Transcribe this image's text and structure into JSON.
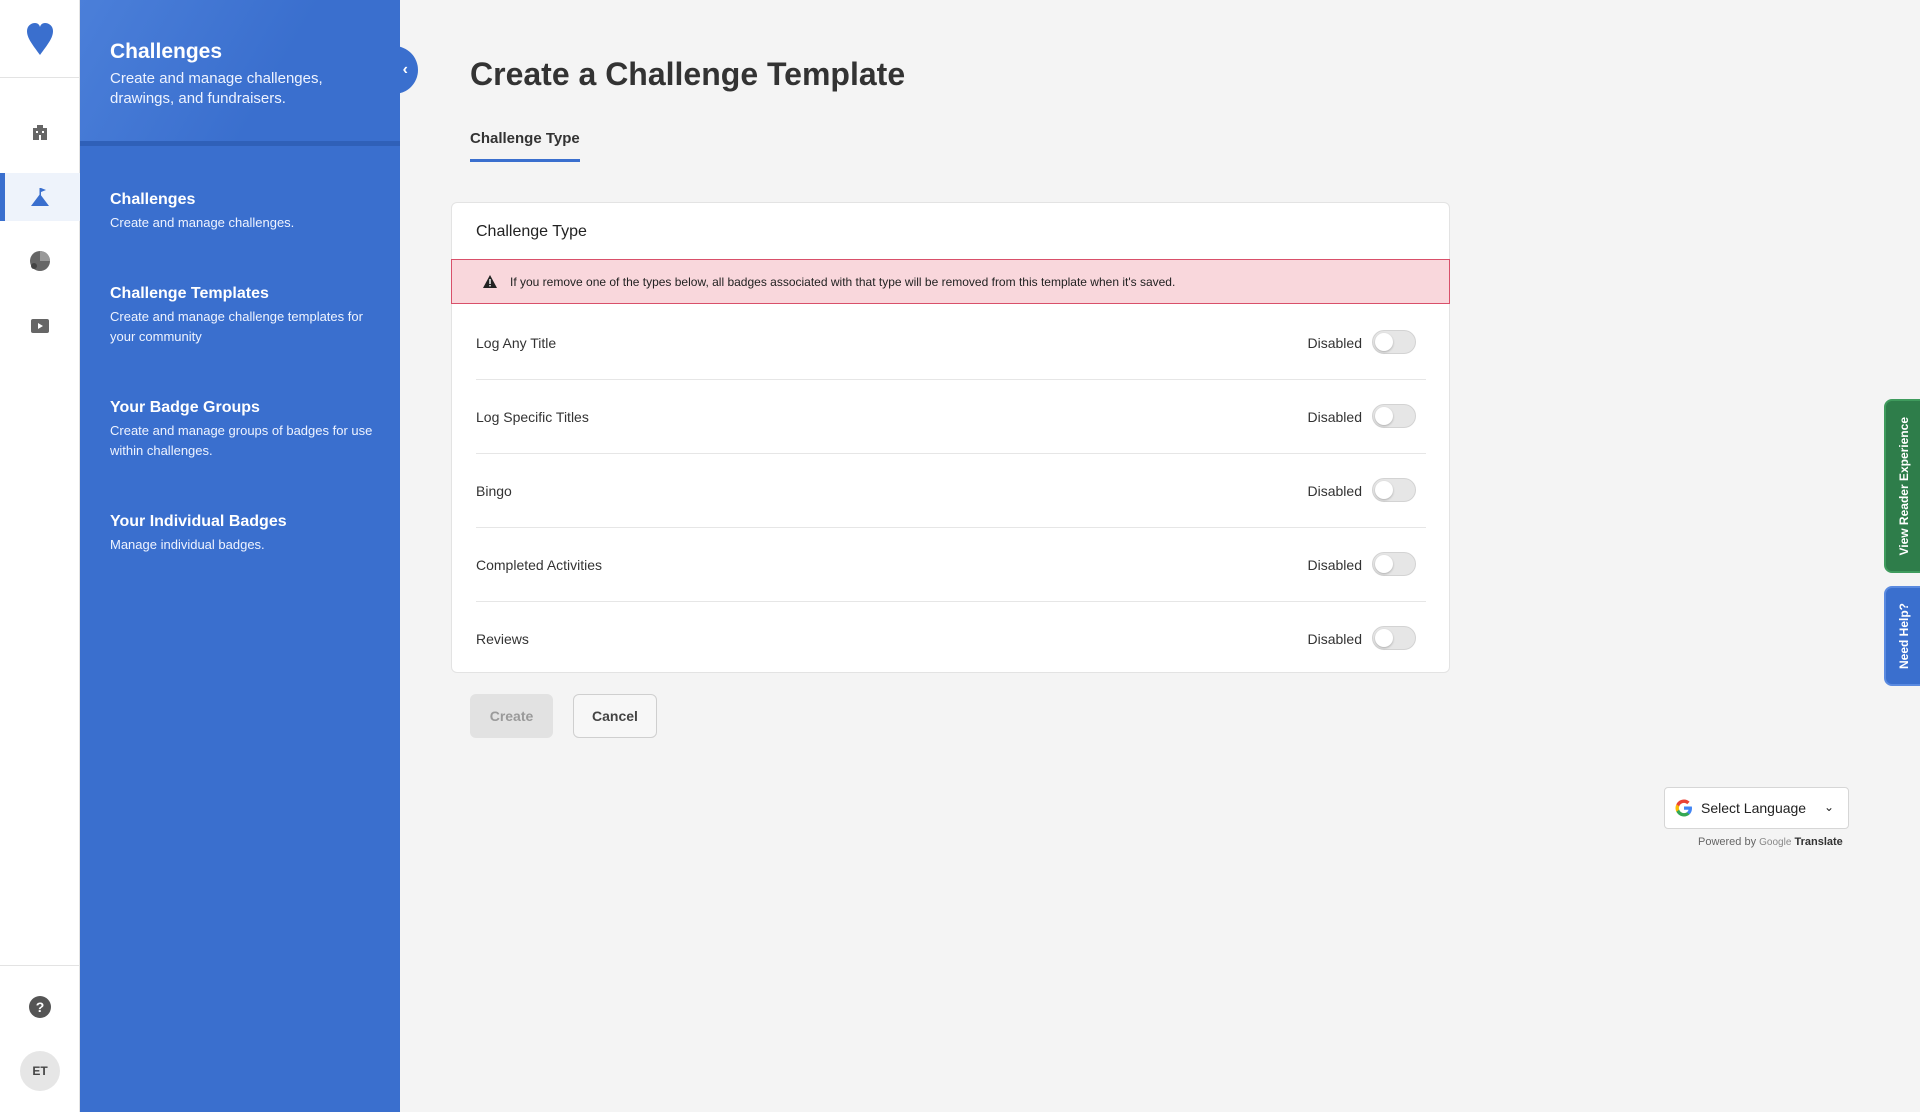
{
  "rail": {
    "items": [
      {
        "icon": "building-icon"
      },
      {
        "icon": "flag-mountain-icon",
        "active": true
      },
      {
        "icon": "pie-chart-icon"
      },
      {
        "icon": "video-play-icon"
      }
    ],
    "help_glyph": "?",
    "avatar_initials": "ET"
  },
  "sidebar": {
    "title": "Challenges",
    "subtitle": "Create and manage challenges, drawings, and fundraisers.",
    "collapse_glyph": "‹",
    "items": [
      {
        "title": "Challenges",
        "desc": "Create and manage challenges."
      },
      {
        "title": "Challenge Templates",
        "desc": "Create and manage challenge templates for your community"
      },
      {
        "title": "Your Badge Groups",
        "desc": "Create and manage groups of badges for use within challenges."
      },
      {
        "title": "Your Individual Badges",
        "desc": "Manage individual badges."
      }
    ]
  },
  "main": {
    "title": "Create a Challenge Template",
    "tab": "Challenge Type",
    "card": {
      "title": "Challenge Type",
      "alert": "If you remove one of the types below, all badges associated with that type will be removed from this template when it's saved.",
      "rows": [
        {
          "label": "Log Any Title",
          "status": "Disabled"
        },
        {
          "label": "Log Specific Titles",
          "status": "Disabled"
        },
        {
          "label": "Bingo",
          "status": "Disabled"
        },
        {
          "label": "Completed Activities",
          "status": "Disabled"
        },
        {
          "label": "Reviews",
          "status": "Disabled"
        }
      ]
    },
    "buttons": {
      "create": "Create",
      "cancel": "Cancel"
    }
  },
  "floating": {
    "reader": "View Reader Experience",
    "help": "Need Help?"
  },
  "translate": {
    "label": "Select Language",
    "powered_by": "Powered by",
    "google": "Google",
    "translate": "Translate"
  },
  "colors": {
    "brand_blue": "#3a6fce",
    "alert_bg": "#f9d7dc",
    "alert_border": "#d9506a",
    "reader_green": "#2e7d4a"
  }
}
